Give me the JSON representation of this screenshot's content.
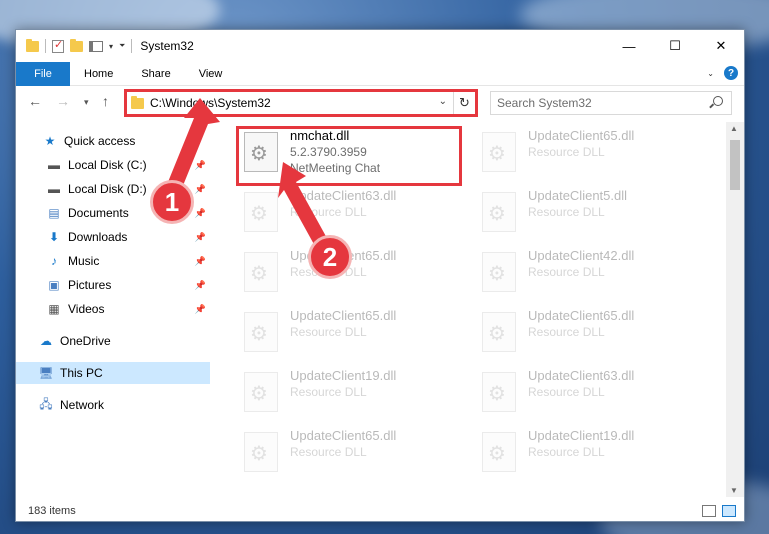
{
  "title": "System32",
  "ribbon": {
    "tabs": [
      "File",
      "Home",
      "Share",
      "View"
    ]
  },
  "address": {
    "path": "C:\\Windows\\System32"
  },
  "search": {
    "placeholder": "Search System32"
  },
  "sidebar": {
    "items": [
      {
        "label": "Quick access",
        "icon": "star-icon"
      },
      {
        "label": "Local Disk (C:)",
        "icon": "drive-icon"
      },
      {
        "label": "Local Disk (D:)",
        "icon": "drive-icon"
      },
      {
        "label": "Documents",
        "icon": "documents-icon"
      },
      {
        "label": "Downloads",
        "icon": "download-icon"
      },
      {
        "label": "Music",
        "icon": "music-icon"
      },
      {
        "label": "Pictures",
        "icon": "pictures-icon"
      },
      {
        "label": "Videos",
        "icon": "videos-icon"
      },
      {
        "label": "OneDrive",
        "icon": "cloud-icon"
      },
      {
        "label": "This PC",
        "icon": "computer-icon"
      },
      {
        "label": "Network",
        "icon": "network-icon"
      }
    ]
  },
  "files": [
    {
      "name": "nmchat.dll",
      "version": "5.2.3790.3959",
      "desc": "NetMeeting Chat"
    },
    {
      "name": "UpdateClient65.dll",
      "desc": "Resource DLL"
    },
    {
      "name": "UpdateClient63.dll",
      "desc": "Resource DLL"
    },
    {
      "name": "UpdateClient5.dll",
      "desc": "Resource DLL"
    },
    {
      "name": "UpdateClient65.dll",
      "desc": "Resource DLL"
    },
    {
      "name": "UpdateClient42.dll",
      "desc": "Resource DLL"
    },
    {
      "name": "UpdateClient65.dll",
      "desc": "Resource DLL"
    },
    {
      "name": "UpdateClient65.dll",
      "desc": "Resource DLL"
    },
    {
      "name": "UpdateClient19.dll",
      "desc": "Resource DLL"
    },
    {
      "name": "UpdateClient63.dll",
      "desc": "Resource DLL"
    },
    {
      "name": "UpdateClient65.dll",
      "desc": "Resource DLL"
    },
    {
      "name": "UpdateClient19.dll",
      "desc": "Resource DLL"
    }
  ],
  "status": {
    "count": "183 items"
  },
  "callouts": {
    "one": "1",
    "two": "2"
  },
  "colors": {
    "accent": "#1979ca",
    "highlight": "#e5373e",
    "selected": "#cce8ff"
  }
}
